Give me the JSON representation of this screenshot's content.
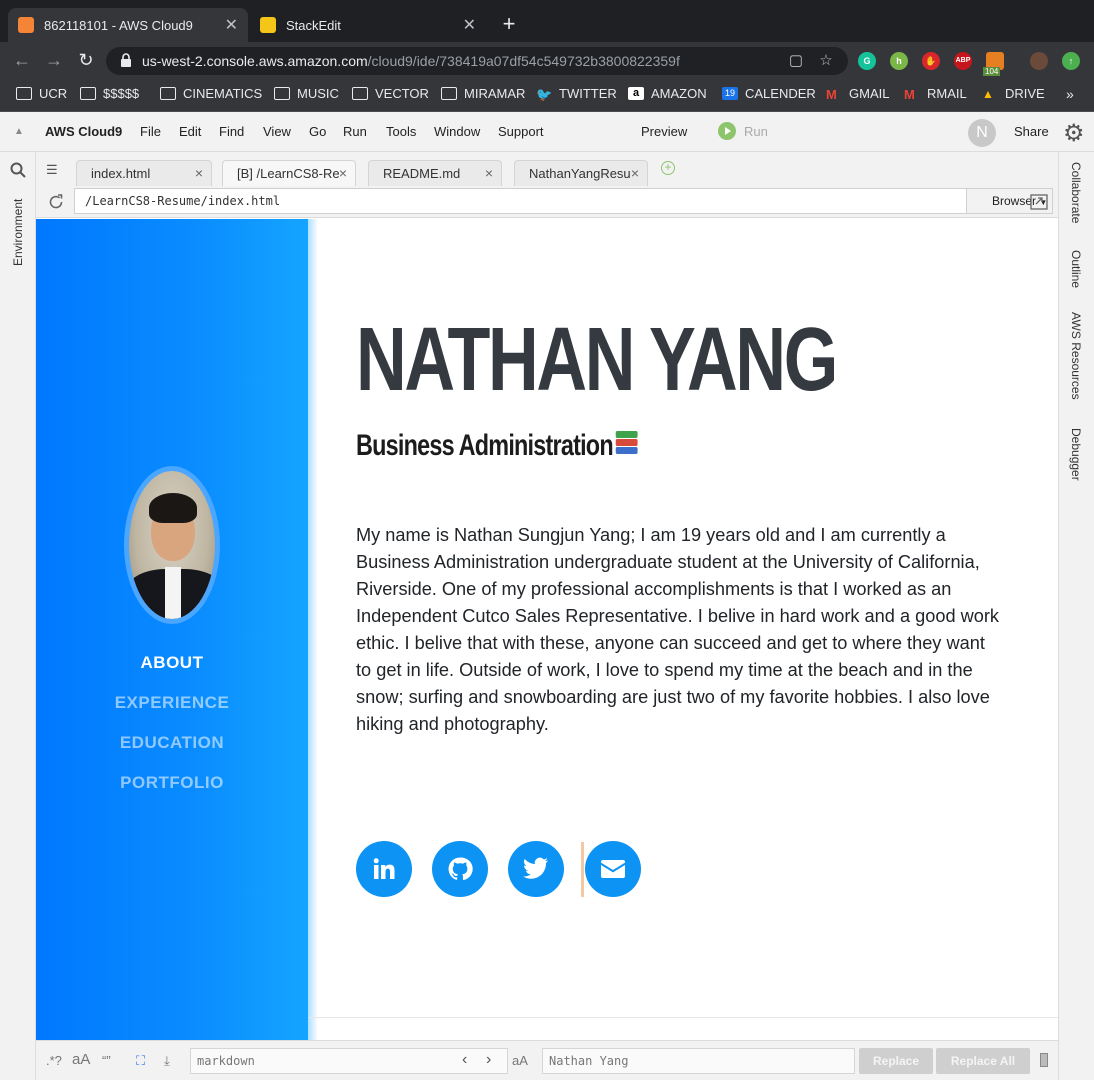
{
  "browser": {
    "tabs": [
      {
        "title": "862118101 - AWS Cloud9",
        "active": true,
        "favicon_color": "#f58536"
      },
      {
        "title": "StackEdit",
        "active": false,
        "favicon_color": "#f5c518"
      }
    ],
    "new_tab": "+",
    "url_host": "us-west-2.console.aws.amazon.com",
    "url_path": "/cloud9/ide/738419a07df54c549732b3800822359f",
    "extension_badge": "104",
    "abp_label": "ABP"
  },
  "bookmarks": [
    {
      "label": "UCR",
      "icon": "folder-icon"
    },
    {
      "label": "$$$$$",
      "icon": "folder-icon"
    },
    {
      "label": "CINEMATICS",
      "icon": "folder-icon"
    },
    {
      "label": "MUSIC",
      "icon": "folder-icon"
    },
    {
      "label": "VECTOR",
      "icon": "folder-icon"
    },
    {
      "label": "MIRAMAR",
      "icon": "folder-icon"
    },
    {
      "label": "TWITTER",
      "icon": "twitter-icon"
    },
    {
      "label": "AMAZON",
      "icon": "amazon-icon"
    },
    {
      "label": "CALENDER",
      "icon": "calendar-icon"
    },
    {
      "label": "GMAIL",
      "icon": "gmail-icon"
    },
    {
      "label": "RMAIL",
      "icon": "gmail-icon"
    },
    {
      "label": "DRIVE",
      "icon": "drive-icon"
    }
  ],
  "calendar_day": "19",
  "ide": {
    "brand": "AWS Cloud9",
    "menu": [
      "File",
      "Edit",
      "Find",
      "View",
      "Go",
      "Run",
      "Tools",
      "Window",
      "Support"
    ],
    "preview": "Preview",
    "run": "Run",
    "avatar_letter": "N",
    "share": "Share",
    "left_panel": "Environment",
    "right_panels": [
      "Collaborate",
      "Outline",
      "AWS Resources",
      "Debugger"
    ],
    "editor_tabs": [
      {
        "label": "index.html",
        "active": false
      },
      {
        "label": "[B] /LearnCS8-Re",
        "active": true
      },
      {
        "label": "README.md",
        "active": false
      },
      {
        "label": "NathanYangResu",
        "active": false
      }
    ],
    "preview_path": "/LearnCS8-Resume/index.html",
    "preview_mode": "Browser"
  },
  "resume": {
    "name": "NATHAN YANG",
    "major": "Business Administration",
    "nav": [
      "ABOUT",
      "EXPERIENCE",
      "EDUCATION",
      "PORTFOLIO"
    ],
    "bio": "My name is Nathan Sungjun Yang; I am 19 years old and I am currently a Business Administration undergraduate student at the University of California, Riverside. One of my professional accomplishments is that I worked as an Independent Cutco Sales Representative. I belive in hard work and a good work ethic. I belive that with these, anyone can succeed and get to where they want to get in life. Outside of work, I love to spend my time at the beach and in the snow; surfing and snowboarding are just two of my favorite hobbies. I also love hiking and photography.",
    "social": [
      "linkedin-icon",
      "github-icon",
      "twitter-icon",
      "envelope-icon"
    ],
    "accent": "#0d93f3"
  },
  "findbar": {
    "regex": ".*?",
    "case": "aA",
    "word": "“”",
    "find_value": "markdown",
    "replace_value": "Nathan Yang",
    "replace": "Replace",
    "replace_all": "Replace All"
  }
}
